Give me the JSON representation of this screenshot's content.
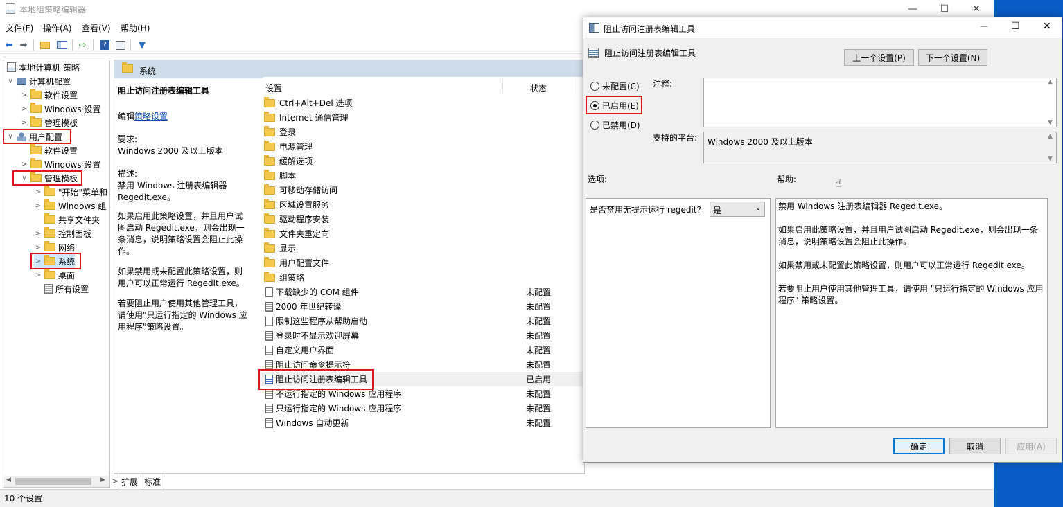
{
  "main_window": {
    "title": "本地组策略编辑器",
    "menu": [
      "文件(F)",
      "操作(A)",
      "查看(V)",
      "帮助(H)"
    ],
    "status": "10 个设置"
  },
  "tree": {
    "items": [
      {
        "label": "本地计算机 策略",
        "level": 0,
        "arrow": ""
      },
      {
        "label": "计算机配置",
        "level": 1,
        "arrow": "∨"
      },
      {
        "label": "软件设置",
        "level": 2,
        "arrow": ">"
      },
      {
        "label": "Windows 设置",
        "level": 2,
        "arrow": ">"
      },
      {
        "label": "管理模板",
        "level": 2,
        "arrow": ">"
      },
      {
        "label": "用户配置",
        "level": 1,
        "arrow": "∨"
      },
      {
        "label": "软件设置",
        "level": 2,
        "arrow": ""
      },
      {
        "label": "Windows 设置",
        "level": 2,
        "arrow": ">"
      },
      {
        "label": "管理模板",
        "level": 2,
        "arrow": "∨"
      },
      {
        "label": "\"开始\"菜单和",
        "level": 3,
        "arrow": ">"
      },
      {
        "label": "Windows 组",
        "level": 3,
        "arrow": ">"
      },
      {
        "label": "共享文件夹",
        "level": 3,
        "arrow": ""
      },
      {
        "label": "控制面板",
        "level": 3,
        "arrow": ">"
      },
      {
        "label": "网络",
        "level": 3,
        "arrow": ">"
      },
      {
        "label": "系统",
        "level": 3,
        "arrow": ">"
      },
      {
        "label": "桌面",
        "level": 3,
        "arrow": ">"
      },
      {
        "label": "所有设置",
        "level": 3,
        "arrow": ""
      }
    ]
  },
  "content": {
    "header": "系统",
    "desc": {
      "title": "阻止访问注册表编辑工具",
      "edit_prefix": "编辑",
      "edit_link": "策略设置",
      "req_label": "要求:",
      "req_value": "Windows 2000 及以上版本",
      "desc_label": "描述:",
      "desc_p1": "禁用 Windows 注册表编辑器 Regedit.exe。",
      "desc_p2": "如果启用此策略设置，并且用户试图启动 Regedit.exe，则会出现一条消息，说明策略设置会阻止此操作。",
      "desc_p3": "如果禁用或未配置此策略设置，则用户可以正常运行 Regedit.exe。",
      "desc_p4": "若要阻止用户使用其他管理工具，请使用\"只运行指定的 Windows 应用程序\"策略设置。"
    },
    "col_setting": "设置",
    "col_state": "状态",
    "folders": [
      "Ctrl+Alt+Del 选项",
      "Internet 通信管理",
      "登录",
      "电源管理",
      "缓解选项",
      "脚本",
      "可移动存储访问",
      "区域设置服务",
      "驱动程序安装",
      "文件夹重定向",
      "显示",
      "用户配置文件",
      "组策略"
    ],
    "policies": [
      {
        "name": "下载缺少的 COM 组件",
        "state": "未配置"
      },
      {
        "name": "2000 年世纪转译",
        "state": "未配置"
      },
      {
        "name": "限制这些程序从帮助启动",
        "state": "未配置"
      },
      {
        "name": "登录时不显示欢迎屏幕",
        "state": "未配置"
      },
      {
        "name": "自定义用户界面",
        "state": "未配置"
      },
      {
        "name": "阻止访问命令提示符",
        "state": "未配置"
      },
      {
        "name": "阻止访问注册表编辑工具",
        "state": "已启用"
      },
      {
        "name": "不运行指定的 Windows 应用程序",
        "state": "未配置"
      },
      {
        "name": "只运行指定的 Windows 应用程序",
        "state": "未配置"
      },
      {
        "name": "Windows 自动更新",
        "state": "未配置"
      }
    ],
    "tabs": [
      "扩展",
      "标准"
    ]
  },
  "dialog": {
    "title": "阻止访问注册表编辑工具",
    "policy_name": "阻止访问注册表编辑工具",
    "prev_btn": "上一个设置(P)",
    "next_btn": "下一个设置(N)",
    "radio_not_configured": "未配置(C)",
    "radio_enabled": "已启用(E)",
    "radio_disabled": "已禁用(D)",
    "comment_label": "注释:",
    "platform_label": "支持的平台:",
    "platform_value": "Windows 2000 及以上版本",
    "options_label": "选项:",
    "help_label": "帮助:",
    "option_question": "是否禁用无提示运行 regedit?",
    "option_value": "是",
    "help_p1": "禁用 Windows 注册表编辑器 Regedit.exe。",
    "help_p2": "如果启用此策略设置，并且用户试图启动 Regedit.exe，则会出现一条消息，说明策略设置会阻止此操作。",
    "help_p3": "如果禁用或未配置此策略设置，则用户可以正常运行 Regedit.exe。",
    "help_p4": "若要阻止用户使用其他管理工具，请使用 \"只运行指定的 Windows 应用程序\" 策略设置。",
    "ok": "确定",
    "cancel": "取消",
    "apply": "应用(A)"
  },
  "colors": {
    "highlight_box": "#e0161e",
    "header_band": "#cfdcea",
    "desktop": "#0a5cc7",
    "primary_border": "#0078d7"
  }
}
